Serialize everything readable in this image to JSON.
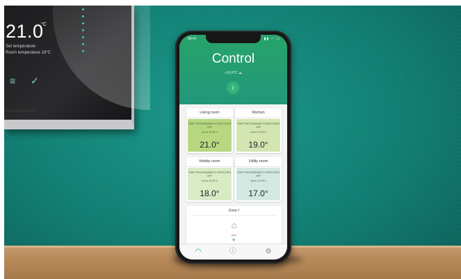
{
  "thermostat": {
    "temperature": "21.0",
    "unit": "°C",
    "line1": "Set temperature",
    "line2": "Room temperature 19°C",
    "brand": "sensoCOMFORT",
    "icon_menu": "menu-icon",
    "icon_check": "check-icon"
  },
  "app": {
    "status": {
      "time": "09:41",
      "icons": "▮▮ ◠ ▭"
    },
    "title": "Control",
    "subtitle": "+10.9°C  ☁",
    "info_icon": "info-icon",
    "accent": "#27a36a",
    "rooms": [
      {
        "name": "Living room",
        "message": "TIME PROGRAMME IS SWITCHED OFF",
        "until": "Up to 10:00 h",
        "temperature": "21.0°",
        "color": "#b7d880"
      },
      {
        "name": "Kitchen",
        "message": "TIME PROGRAMME IS SWITCHED OFF",
        "until": "Up to 10:00 h",
        "temperature": "19.0°",
        "color": "#d3e5b0"
      },
      {
        "name": "Hobby room",
        "message": "TIME PROGRAMME IS SWITCHED OFF",
        "until": "Up to 10:00 h",
        "temperature": "18.0°",
        "color": "#d8ebc5"
      },
      {
        "name": "Utility room",
        "message": "TIME PROGRAMME IS SWITCHED OFF",
        "until": "Up to 10:00 h",
        "temperature": "17.0°",
        "color": "#d2e9e3"
      }
    ],
    "zone": {
      "name": "Zone I",
      "mode": "auto",
      "icon": "house-icon"
    },
    "tabs": [
      {
        "icon": "control-icon"
      },
      {
        "icon": "info-icon"
      },
      {
        "icon": "settings-icon"
      }
    ]
  }
}
